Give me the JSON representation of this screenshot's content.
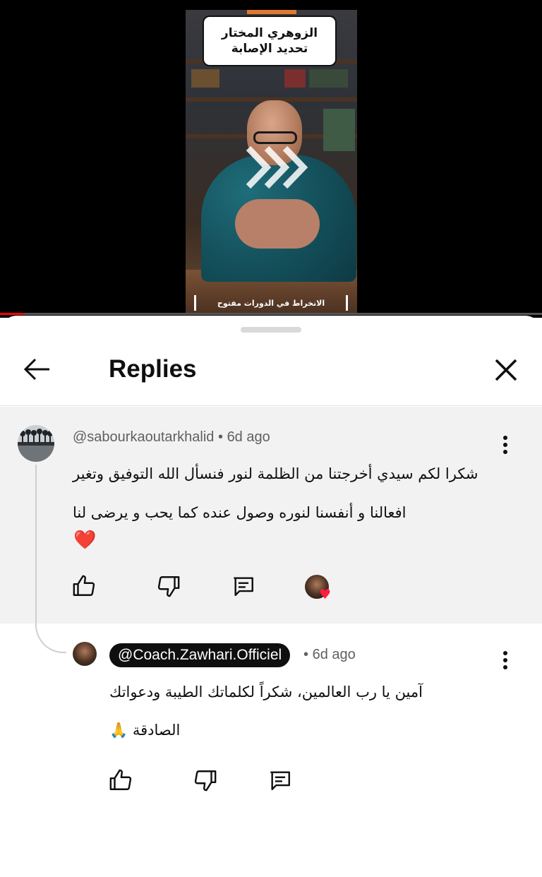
{
  "video": {
    "title_line1": "الزوهري المختار",
    "title_line2": "تحديد الإصابة",
    "caption": "الانخراط في الدورات مفتوح",
    "progress_fraction": 0.044
  },
  "replies_sheet": {
    "title": "Replies",
    "back_icon": "arrow-left-icon",
    "close_icon": "close-icon"
  },
  "parent_comment": {
    "author": "@sabourkaoutarkhalid",
    "time": "6d ago",
    "text": "شكرا لكم سيدي أخرجتنا من الظلمة لنور فنسأل الله التوفيق وتغير  افعالنا و أنفسنا لنوره وصول عنده كما يحب و يرضى لنا",
    "emoji": "❤️",
    "creator_heart": true
  },
  "reply": {
    "author": "@Coach.Zawhari.Officiel",
    "time": "6d ago",
    "text": "آمين يا رب العالمين، شكراً لكلماتك الطيبة ودعواتك الصادقة 🙏"
  },
  "meta_separator": "•",
  "colors": {
    "accent_red": "#ff0000",
    "heart_red": "#ff1f3d",
    "parent_bg": "#f2f2f2",
    "creator_badge_bg": "#0f0f0f"
  }
}
